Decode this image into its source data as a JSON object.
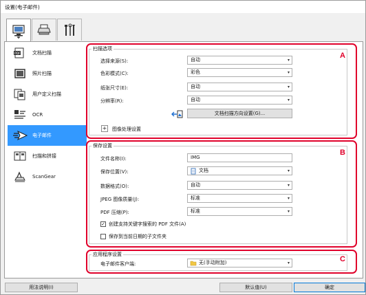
{
  "window": {
    "title": "设置(电子邮件)"
  },
  "tabs": [
    {
      "icon": "scan-from-computer-icon",
      "active": true
    },
    {
      "icon": "scan-from-operation-panel-icon",
      "active": false
    },
    {
      "icon": "tools-icon",
      "active": false
    }
  ],
  "sidebar": {
    "items": [
      {
        "label": "文档扫描",
        "icon": "document-scan-icon"
      },
      {
        "label": "照片扫描",
        "icon": "photo-scan-icon"
      },
      {
        "label": "用户定义扫描",
        "icon": "custom-scan-icon"
      },
      {
        "label": "OCR",
        "icon": "ocr-icon"
      },
      {
        "label": "电子邮件",
        "icon": "email-icon",
        "selected": true
      },
      {
        "label": "扫描和拼接",
        "icon": "scan-stitch-icon"
      },
      {
        "label": "ScanGear",
        "icon": "scangear-icon"
      }
    ]
  },
  "scan_options": {
    "title": "扫描选项",
    "badge": "A",
    "rows": [
      {
        "label": "选择来源(S):",
        "value": "自动"
      },
      {
        "label": "色彩模式(C):",
        "value": "彩色"
      },
      {
        "label": "纸张尺寸(E):",
        "value": "自动"
      },
      {
        "label": "分辨率(R):",
        "value": "自动"
      }
    ],
    "orientation_button": "文档扫描方向设置(G)...",
    "image_processing_label": "图像处理设置",
    "plus": "+"
  },
  "save_settings": {
    "title": "保存设置",
    "badge": "B",
    "filename_label": "文件名称(I):",
    "filename_value": "IMG",
    "save_location_label": "保存位置(V):",
    "save_location_value": "文档",
    "format_label": "数据格式(O):",
    "format_value": "自动",
    "jpeg_label": "JPEG 图像质量(J):",
    "jpeg_value": "标准",
    "pdf_label": "PDF 压缩(P):",
    "pdf_value": "标准",
    "check_keyword_label": "创建支持关键字搜索的 PDF 文件(A)",
    "check_keyword_checked": true,
    "check_subfolder_label": "保存到当前日期的子文件夹",
    "check_subfolder_checked": false
  },
  "app_settings": {
    "title": "应用程序设置",
    "badge": "C",
    "client_label": "电子邮件客户端:",
    "client_value": "无(手动附加)"
  },
  "footer": {
    "help_button": "用法说明(I)",
    "default_button": "默认值(U)",
    "ok_button": "确定"
  },
  "colors": {
    "accent": "#3399ff",
    "highlight": "#e0002a"
  }
}
